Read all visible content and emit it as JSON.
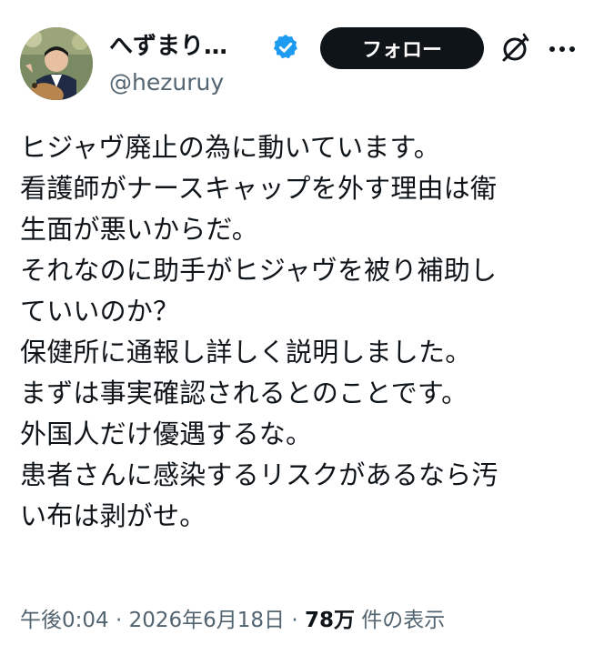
{
  "user": {
    "display_name": "へずまり…",
    "handle": "@hezuruy",
    "verified_color": "#1d9bf0"
  },
  "actions": {
    "follow_label": "フォロー",
    "grok_icon": "slashed-circle-icon",
    "more_icon": "more-horizontal-icon"
  },
  "tweet": {
    "lines": [
      "ヒジャヴ廃止の為に動いています。",
      "看護師がナースキャップを外す理由は衛",
      "生面が悪いからだ。",
      "それなのに助手がヒジャヴを被り補助し",
      "ていいのか？",
      "保健所に通報し詳しく説明しました。",
      "まずは事実確認されるとのことです。",
      "外国人だけ優遇するな。",
      "患者さんに感染するリスクがあるなら汚",
      "い布は剥がせ。"
    ]
  },
  "meta": {
    "time": "午後0:04",
    "separator": " · ",
    "date": "2026年6月18日",
    "views_count": "78万",
    "views_label": " 件の表示"
  }
}
